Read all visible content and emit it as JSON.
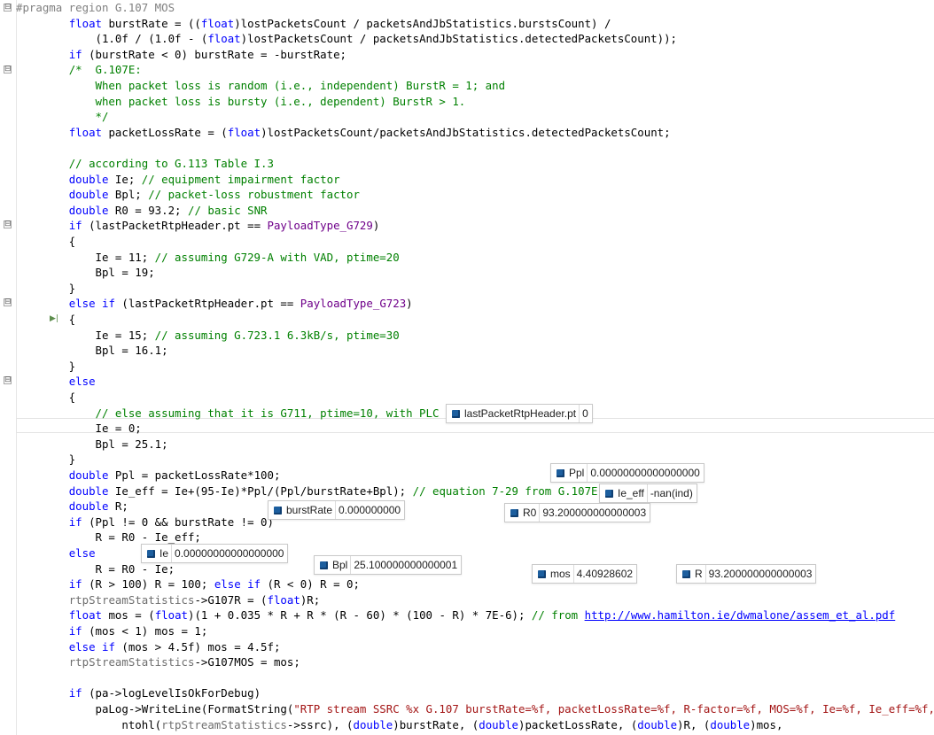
{
  "editor": {
    "lines": [
      [
        [
          "pp",
          "#pragma region G.107 MOS"
        ]
      ],
      [
        [
          "",
          "        "
        ],
        [
          "kw",
          "float"
        ],
        [
          "",
          " burstRate = (("
        ],
        [
          "kw",
          "float"
        ],
        [
          "",
          ")lostPacketsCount / packetsAndJbStatistics.burstsCount) /"
        ]
      ],
      [
        [
          "",
          "            (1.0f / (1.0f - ("
        ],
        [
          "kw",
          "float"
        ],
        [
          "",
          ")lostPacketsCount / packetsAndJbStatistics.detectedPacketsCount));"
        ]
      ],
      [
        [
          "",
          "        "
        ],
        [
          "kw",
          "if"
        ],
        [
          "",
          " (burstRate < 0) burstRate = -burstRate;"
        ]
      ],
      [
        [
          "",
          "        "
        ],
        [
          "cm",
          "/*  G.107E:"
        ]
      ],
      [
        [
          "cm",
          "            When packet loss is random (i.e., independent) BurstR = 1; and"
        ]
      ],
      [
        [
          "cm",
          "            when packet loss is bursty (i.e., dependent) BurstR > 1."
        ]
      ],
      [
        [
          "cm",
          "            */"
        ]
      ],
      [
        [
          "",
          "        "
        ],
        [
          "kw",
          "float"
        ],
        [
          "",
          " packetLossRate = ("
        ],
        [
          "kw",
          "float"
        ],
        [
          "",
          ")lostPacketsCount/packetsAndJbStatistics.detectedPacketsCount;"
        ]
      ],
      [
        [
          "",
          ""
        ]
      ],
      [
        [
          "",
          "        "
        ],
        [
          "cm",
          "// according to G.113 Table I.3"
        ]
      ],
      [
        [
          "",
          "        "
        ],
        [
          "kw",
          "double"
        ],
        [
          "",
          " Ie; "
        ],
        [
          "cm",
          "// equipment impairment factor"
        ]
      ],
      [
        [
          "",
          "        "
        ],
        [
          "kw",
          "double"
        ],
        [
          "",
          " Bpl; "
        ],
        [
          "cm",
          "// packet-loss robustment factor"
        ]
      ],
      [
        [
          "",
          "        "
        ],
        [
          "kw",
          "double"
        ],
        [
          "",
          " R0 = 93.2; "
        ],
        [
          "cm",
          "// basic SNR"
        ]
      ],
      [
        [
          "",
          "        "
        ],
        [
          "kw",
          "if"
        ],
        [
          "",
          " (lastPacketRtpHeader.pt == "
        ],
        [
          "mac",
          "PayloadType_G729"
        ],
        [
          "",
          ")"
        ]
      ],
      [
        [
          "",
          "        {"
        ]
      ],
      [
        [
          "",
          "            Ie = 11; "
        ],
        [
          "cm",
          "// assuming G729-A with VAD, ptime=20"
        ]
      ],
      [
        [
          "",
          "            Bpl = 19;"
        ]
      ],
      [
        [
          "",
          "        }"
        ]
      ],
      [
        [
          "",
          "        "
        ],
        [
          "kw",
          "else"
        ],
        [
          "",
          " "
        ],
        [
          "kw",
          "if"
        ],
        [
          "",
          " (lastPacketRtpHeader.pt == "
        ],
        [
          "mac",
          "PayloadType_G723"
        ],
        [
          "",
          ")"
        ]
      ],
      [
        [
          "",
          "        {"
        ]
      ],
      [
        [
          "",
          "            Ie = 15; "
        ],
        [
          "cm",
          "// assuming G.723.1 6.3kB/s, ptime=30"
        ]
      ],
      [
        [
          "",
          "            Bpl = 16.1;"
        ]
      ],
      [
        [
          "",
          "        }"
        ]
      ],
      [
        [
          "",
          "        "
        ],
        [
          "kw",
          "else"
        ]
      ],
      [
        [
          "",
          "        {"
        ]
      ],
      [
        [
          "",
          "            "
        ],
        [
          "cm",
          "// else assuming that it is G711, ptime=10, with PLC"
        ]
      ],
      [
        [
          "",
          "            Ie = 0;"
        ]
      ],
      [
        [
          "",
          "            Bpl = 25.1;"
        ]
      ],
      [
        [
          "",
          "        }"
        ]
      ],
      [
        [
          "",
          "        "
        ],
        [
          "kw",
          "double"
        ],
        [
          "",
          " Ppl = packetLossRate*100;"
        ]
      ],
      [
        [
          "",
          "        "
        ],
        [
          "kw",
          "double"
        ],
        [
          "",
          " Ie_eff = Ie+(95-Ie)*Ppl/(Ppl/burstRate+Bpl); "
        ],
        [
          "cm",
          "// equation 7-29 from G.107E"
        ]
      ],
      [
        [
          "",
          "        "
        ],
        [
          "kw",
          "double"
        ],
        [
          "",
          " R;"
        ]
      ],
      [
        [
          "",
          "        "
        ],
        [
          "kw",
          "if"
        ],
        [
          "",
          " (Ppl != 0 && burstRate != 0)"
        ]
      ],
      [
        [
          "",
          "            R = R0 - Ie_eff;"
        ]
      ],
      [
        [
          "",
          "        "
        ],
        [
          "kw",
          "else"
        ]
      ],
      [
        [
          "",
          "            R = R0 - Ie;"
        ]
      ],
      [
        [
          "",
          "        "
        ],
        [
          "kw",
          "if"
        ],
        [
          "",
          " (R > 100) R = 100; "
        ],
        [
          "kw",
          "else"
        ],
        [
          "",
          " "
        ],
        [
          "kw",
          "if"
        ],
        [
          "",
          " (R < 0) R = 0;"
        ]
      ],
      [
        [
          "",
          "        "
        ],
        [
          "mem",
          "rtpStreamStatistics"
        ],
        [
          "",
          "->G107R = ("
        ],
        [
          "kw",
          "float"
        ],
        [
          "",
          ")R;"
        ]
      ],
      [
        [
          "",
          "        "
        ],
        [
          "kw",
          "float"
        ],
        [
          "",
          " mos = ("
        ],
        [
          "kw",
          "float"
        ],
        [
          "",
          ")(1 + 0.035 * R + R * (R - 60) * (100 - R) * 7E-6); "
        ],
        [
          "cm",
          "// from "
        ],
        [
          "lnk",
          "http://www.hamilton.ie/dwmalone/assem_et_al.pdf"
        ]
      ],
      [
        [
          "",
          "        "
        ],
        [
          "kw",
          "if"
        ],
        [
          "",
          " (mos < 1) mos = 1;"
        ]
      ],
      [
        [
          "",
          "        "
        ],
        [
          "kw",
          "else"
        ],
        [
          "",
          " "
        ],
        [
          "kw",
          "if"
        ],
        [
          "",
          " (mos > 4.5f) mos = 4.5f;"
        ]
      ],
      [
        [
          "",
          "        "
        ],
        [
          "mem",
          "rtpStreamStatistics"
        ],
        [
          "",
          "->G107MOS = mos;"
        ]
      ],
      [
        [
          "",
          ""
        ]
      ],
      [
        [
          "",
          "        "
        ],
        [
          "kw",
          "if"
        ],
        [
          "",
          " (pa->logLevelIsOkForDebug)"
        ]
      ],
      [
        [
          "",
          "            paLog->WriteLine(FormatString("
        ],
        [
          "str",
          "\"RTP stream SSRC %x G.107 burstRate=%f, packetLossRate=%f, R-factor=%f, MOS=%f, Ie=%f, Ie_eff=%f,"
        ]
      ],
      [
        [
          "",
          "                ntohl("
        ],
        [
          "mem",
          "rtpStreamStatistics"
        ],
        [
          "",
          "->ssrc), ("
        ],
        [
          "kw",
          "double"
        ],
        [
          "",
          ")burstRate, ("
        ],
        [
          "kw",
          "double"
        ],
        [
          "",
          ")packetLossRate, ("
        ],
        [
          "kw",
          "double"
        ],
        [
          "",
          ")R, ("
        ],
        [
          "kw",
          "double"
        ],
        [
          "",
          ")mos,"
        ]
      ]
    ]
  },
  "tips": [
    {
      "name": "lastPacketRtpHeader.pt",
      "value": "0"
    },
    {
      "name": "Ppl",
      "value": "0.00000000000000000"
    },
    {
      "name": "Ie_eff",
      "value": "-nan(ind)"
    },
    {
      "name": "burstRate",
      "value": "0.000000000"
    },
    {
      "name": "R0",
      "value": "93.200000000000003"
    },
    {
      "name": "Ie",
      "value": "0.00000000000000000"
    },
    {
      "name": "Bpl",
      "value": "25.100000000000001"
    },
    {
      "name": "mos",
      "value": "4.40928602"
    },
    {
      "name": "R",
      "value": "93.200000000000003"
    }
  ],
  "fold_markers": [
    "⊟",
    "⊟",
    "⊟",
    "⊟",
    "⊟"
  ]
}
